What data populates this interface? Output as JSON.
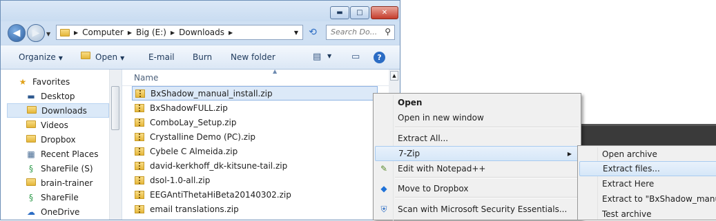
{
  "window": {
    "minimize_glyph": "▬",
    "maximize_glyph": "□",
    "close_glyph": "✕"
  },
  "address": {
    "segments": [
      "Computer",
      "Big (E:)",
      "Downloads"
    ],
    "search_placeholder": "Search Do..."
  },
  "toolbar": {
    "organize": "Organize",
    "open": "Open",
    "email": "E-mail",
    "burn": "Burn",
    "new_folder": "New folder"
  },
  "nav_pane": {
    "items": [
      {
        "label": "Favorites",
        "icon": "star-icon"
      },
      {
        "label": "Desktop",
        "icon": "desktop-icon"
      },
      {
        "label": "Downloads",
        "icon": "folder-icon"
      },
      {
        "label": "Videos",
        "icon": "folder-icon"
      },
      {
        "label": "Dropbox",
        "icon": "folder-icon"
      },
      {
        "label": "Recent Places",
        "icon": "recent-places-icon"
      },
      {
        "label": "ShareFile (S)",
        "icon": "sharefile-icon"
      },
      {
        "label": "brain-trainer",
        "icon": "folder-icon"
      },
      {
        "label": "ShareFile",
        "icon": "sharefile-icon"
      },
      {
        "label": "OneDrive",
        "icon": "onedrive-icon"
      }
    ],
    "selected": "Downloads"
  },
  "file_list": {
    "column_name": "Name",
    "files": [
      "BxShadow_manual_install.zip",
      "BxShadowFULL.zip",
      "ComboLay_Setup.zip",
      "Crystalline Demo (PC).zip",
      "Cybele C Almeida.zip",
      "david-kerkhoff_dk-kitsune-tail.zip",
      "dsol-1.0-all.zip",
      "EEGAntiThetaHiBeta20140302.zip",
      "email translations.zip"
    ],
    "selected": "BxShadow_manual_install.zip"
  },
  "context_menu": {
    "open": "Open",
    "open_new_window": "Open in new window",
    "extract_all": "Extract All...",
    "seven_zip": "7-Zip",
    "edit_notepad": "Edit with Notepad++",
    "move_dropbox": "Move to Dropbox",
    "scan_mse": "Scan with Microsoft Security Essentials..."
  },
  "submenu_7zip": {
    "open_archive": "Open archive",
    "extract_files": "Extract files...",
    "extract_here": "Extract Here",
    "extract_to": "Extract to \"BxShadow_manual_in",
    "test_archive": "Test archive"
  }
}
